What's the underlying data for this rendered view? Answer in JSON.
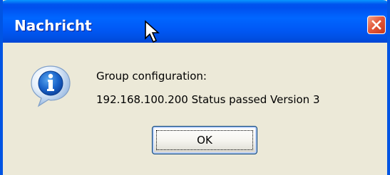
{
  "window": {
    "title": "Nachricht",
    "accent_color": "#0054e3",
    "close_color": "#e3593b"
  },
  "message": {
    "icon": "info-icon",
    "heading": "Group configuration:",
    "body": "192.168.100.200 Status passed Version 3"
  },
  "buttons": {
    "ok_label": "OK"
  },
  "cursor": {
    "icon": "mouse-pointer-icon"
  }
}
